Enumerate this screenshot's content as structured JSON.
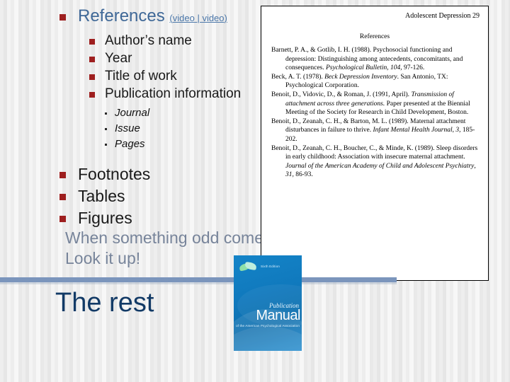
{
  "slide": {
    "title": "References",
    "title_links": "(video | video)",
    "link_one": "video",
    "link_sep": " | ",
    "link_two": "video",
    "open_paren": "(",
    "close_paren": ")",
    "bullets_level1_group1": [
      "Author’s name",
      "Year",
      "Title of work",
      "Publication information"
    ],
    "bullets_level3": [
      "Journal",
      "Issue",
      "Pages"
    ],
    "bullets_level1_group2": [
      "Footnotes",
      "Tables",
      "Figures"
    ],
    "remark": "When something odd comes up, don’t guess.  Look it up!",
    "rest_title": "The rest"
  },
  "reference_panel": {
    "running_head": "Adolescent Depression 29",
    "section_title": "References",
    "entries": [
      {
        "line1": "Barnett, P. A., & Gotlib, I. H. (1988). Psychosocial",
        "line2": "functioning and depression: Distinguishing among",
        "line3": "antecedents, concomitants, and consequences.",
        "italic": "Psychological Bulletin, 104,",
        "tail": " 97-126."
      },
      {
        "line1": "Beck, A. T. (1978). ",
        "italic1": "Beck Depression Inventory",
        "tail1": ".",
        "line2": "San Antonio, TX: Psychological Corporation."
      },
      {
        "line1": "Benoit, D., Vidovic, D., & Roman, J. (1991, April).",
        "italic1": "Transmission of attachment across three generations.",
        "line2": "Paper presented at the Biennial Meeting of the Society",
        "line3": "for Research in Child Development, Boston."
      },
      {
        "line1": "Benoit, D., Zeanah, C. H., & Barton, M. L. (1989).",
        "line2": "Maternal attachment disturbances in failure to thrive.",
        "italic1": "Infant Mental Health Journal, 3,",
        "tail1": " 185-202."
      },
      {
        "line1": "Benoit, D., Zeanah, C. H., Boucher, C., & Minde, K.",
        "line2": "(1989). Sleep disorders in early childhood: Association",
        "line3": "with insecure maternal attachment. ",
        "italic1": "Journal of the",
        "italic2": "American Academy of Child and Adolescent Psychiatry",
        "tail1": ",",
        "italic3": "31,",
        "tail2": " 86-93."
      }
    ]
  },
  "book_cover": {
    "edition": "Sixth Edition",
    "publication": "Publication",
    "manual": "Manual",
    "association": "of the American Psychological Association"
  },
  "colors": {
    "title_blue": "#3f6897",
    "bullet_red": "#9e1f1f",
    "remark_gray": "#77849a",
    "rest_navy": "#123a66",
    "divider_blue": "#7b95bc",
    "book_blue": "#1079bd"
  }
}
